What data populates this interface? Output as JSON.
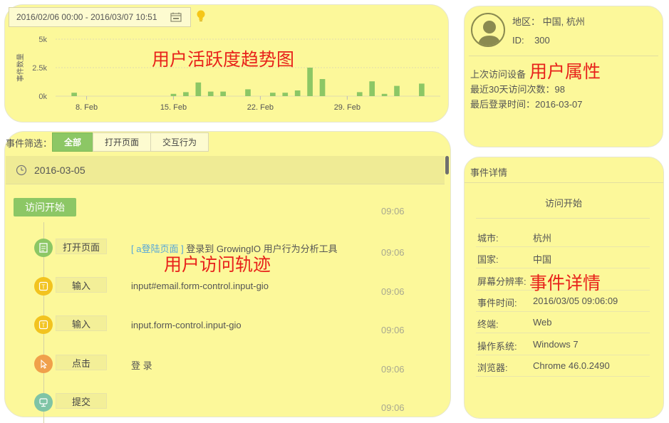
{
  "chart_panel": {
    "date_range": "2016/02/06 00:00 - 2016/03/07 10:51",
    "overlay_label": "用户活跃度趋势图"
  },
  "chart_data": {
    "type": "bar",
    "ylabel": "事件数量",
    "y_ticks": [
      "5k",
      "2.5k",
      "0k"
    ],
    "ylim": [
      0,
      5000
    ],
    "x_ticks": [
      "8. Feb",
      "15. Feb",
      "22. Feb",
      "29. Feb"
    ],
    "x_tick_days": [
      2,
      9,
      16,
      23
    ],
    "categories": [
      "Feb 6",
      "Feb 7",
      "Feb 8",
      "Feb 9",
      "Feb 10",
      "Feb 11",
      "Feb 12",
      "Feb 13",
      "Feb 14",
      "Feb 15",
      "Feb 16",
      "Feb 17",
      "Feb 18",
      "Feb 19",
      "Feb 20",
      "Feb 21",
      "Feb 22",
      "Feb 23",
      "Feb 24",
      "Feb 25",
      "Feb 26",
      "Feb 27",
      "Feb 28",
      "Feb 29",
      "Mar 1",
      "Mar 2",
      "Mar 3",
      "Mar 4",
      "Mar 5",
      "Mar 6",
      "Mar 7"
    ],
    "values": [
      0,
      300,
      0,
      0,
      0,
      0,
      0,
      0,
      0,
      200,
      350,
      1200,
      400,
      400,
      0,
      600,
      0,
      300,
      300,
      500,
      2500,
      1500,
      0,
      0,
      350,
      1300,
      200,
      900,
      0,
      1100,
      0
    ],
    "color": "#8cc765",
    "grid": true
  },
  "profile": {
    "region_label": "地区：",
    "region_value": "中国, 杭州",
    "id_label": "ID:",
    "id_value": "300",
    "last_device": "上次访问设备",
    "visits_30d": "最近30天访问次数：98",
    "last_login": "最后登录时间：2016-03-07",
    "overlay_label": "用户属性"
  },
  "filter": {
    "label": "事件筛选：",
    "tabs": [
      "全部",
      "打开页面",
      "交互行为"
    ],
    "active_tab": "全部"
  },
  "trail": {
    "date": "2016-03-05",
    "visit_start": "访问开始",
    "visit_start_time": "09:06",
    "overlay_label": "用户访问轨迹",
    "events": [
      {
        "label": "打开页面",
        "icon": "page-icon",
        "color": "#8cc765",
        "desc_link": "[ a登陆页面 ]",
        "desc": " 登录到 GrowingIO 用户行为分析工具",
        "time": "09:06"
      },
      {
        "label": "输入",
        "icon": "text-input-icon",
        "color": "#f2c31f",
        "desc_link": "",
        "desc": "input#email.form-control.input-gio",
        "time": "09:06"
      },
      {
        "label": "输入",
        "icon": "text-input-icon",
        "color": "#f2c31f",
        "desc_link": "",
        "desc": "input.form-control.input-gio",
        "time": "09:06"
      },
      {
        "label": "点击",
        "icon": "cursor-icon",
        "color": "#f0a04b",
        "desc_link": "",
        "desc": "登 录",
        "time": "09:06"
      },
      {
        "label": "提交",
        "icon": "submit-icon",
        "color": "#7fc4a6",
        "desc_link": "",
        "desc": "",
        "time": "09:06"
      }
    ]
  },
  "detail": {
    "header": "事件详情",
    "title": "访问开始",
    "overlay_label": "事件详情",
    "rows": [
      {
        "key": "城市:",
        "value": "杭州"
      },
      {
        "key": "国家:",
        "value": "中国"
      },
      {
        "key": "屏幕分辨率:",
        "value": ""
      },
      {
        "key": "事件时间:",
        "value": "2016/03/05 09:06:09"
      },
      {
        "key": "终端:",
        "value": "Web"
      },
      {
        "key": "操作系统:",
        "value": "Windows 7"
      },
      {
        "key": "浏览器:",
        "value": "Chrome 46.0.2490"
      }
    ]
  }
}
